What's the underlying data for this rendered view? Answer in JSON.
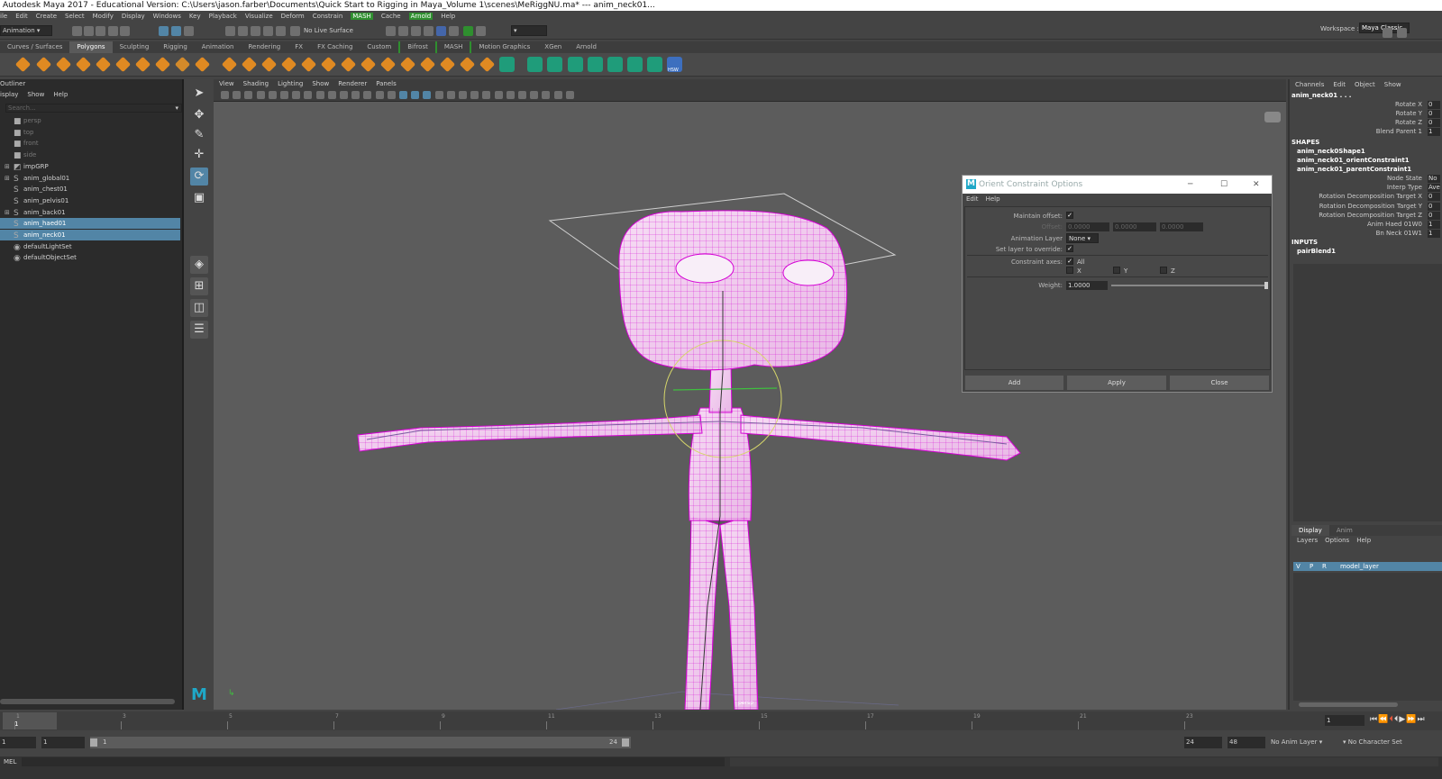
{
  "window": {
    "title": "Autodesk Maya 2017 - Educational Version: C:\\Users\\jason.farber\\Documents\\Quick Start to Rigging in Maya_Volume 1\\scenes\\MeRiggNU.ma*   ---   anim_neck01..."
  },
  "menubar": {
    "items": [
      "ile",
      "Edit",
      "Create",
      "Select",
      "Modify",
      "Display",
      "Windows",
      "Key",
      "Playback",
      "Visualize",
      "Deform",
      "Constrain",
      "MASH",
      "Cache",
      "Arnold",
      "Help"
    ],
    "workspace_label": "Workspace :",
    "workspace_value": "Maya Classic"
  },
  "statusline": {
    "mode": "Animation",
    "live_surface": "No Live Surface"
  },
  "shelf": {
    "tabs": [
      "Curves / Surfaces",
      "Polygons",
      "Sculpting",
      "Rigging",
      "Animation",
      "Rendering",
      "FX",
      "FX Caching",
      "Custom",
      "Bifrost",
      "MASH",
      "Motion Graphics",
      "XGen",
      "Arnold"
    ],
    "active": "Polygons",
    "hsw_label": "HSW"
  },
  "outliner": {
    "title": "Outliner",
    "menu": [
      "isplay",
      "Show",
      "Help"
    ],
    "search_placeholder": "Search...",
    "items": [
      {
        "label": "persp",
        "state": "dim"
      },
      {
        "label": "top",
        "state": "dim"
      },
      {
        "label": "front",
        "state": "dim"
      },
      {
        "label": "side",
        "state": "dim"
      },
      {
        "label": "impGRP",
        "state": "normal"
      },
      {
        "label": "anim_global01",
        "state": "normal"
      },
      {
        "label": "anim_chest01",
        "state": "normal"
      },
      {
        "label": "anim_pelvis01",
        "state": "normal"
      },
      {
        "label": "anim_back01",
        "state": "normal"
      },
      {
        "label": "anim_haed01",
        "state": "selected"
      },
      {
        "label": "anim_neck01",
        "state": "selected"
      },
      {
        "label": "defaultLightSet",
        "state": "normal"
      },
      {
        "label": "defaultObjectSet",
        "state": "normal"
      }
    ]
  },
  "viewport": {
    "menu": [
      "View",
      "Shading",
      "Lighting",
      "Show",
      "Renderer",
      "Panels"
    ],
    "camera_label": "persp"
  },
  "dialog": {
    "title": "Orient Constraint Options",
    "menu": [
      "Edit",
      "Help"
    ],
    "maintain_offset_label": "Maintain offset:",
    "offset_label": "Offset:",
    "offset_values": [
      "0.0000",
      "0.0000",
      "0.0000"
    ],
    "anim_layer_label": "Animation Layer",
    "anim_layer_value": "None",
    "set_layer_label": "Set layer to override:",
    "constraint_axes_label": "Constraint axes:",
    "all_label": "All",
    "axes": [
      "X",
      "Y",
      "Z"
    ],
    "weight_label": "Weight:",
    "weight_value": "1.0000",
    "weight_fraction": 1.0,
    "buttons": {
      "add": "Add",
      "apply": "Apply",
      "close": "Close"
    }
  },
  "channels": {
    "tabs": [
      "Channels",
      "Edit",
      "Object",
      "Show"
    ],
    "node": "anim_neck01 . . .",
    "attrs": [
      {
        "name": "Rotate X",
        "value": "0"
      },
      {
        "name": "Rotate Y",
        "value": "0"
      },
      {
        "name": "Rotate Z",
        "value": "0"
      },
      {
        "name": "Blend Parent 1",
        "value": "1"
      }
    ],
    "shapes_header": "SHAPES",
    "shapes": [
      "anim_neck0Shape1",
      "anim_neck01_orientConstraint1",
      "anim_neck01_parentConstraint1"
    ],
    "constraint_attrs": [
      {
        "name": "Node State",
        "value": "No"
      },
      {
        "name": "Interp Type",
        "value": "Ave"
      },
      {
        "name": "Rotation Decomposition Target X",
        "value": "0"
      },
      {
        "name": "Rotation Decomposition Target Y",
        "value": "0"
      },
      {
        "name": "Rotation Decomposition Target Z",
        "value": "0"
      },
      {
        "name": "Anim Haed 01W0",
        "value": "1"
      },
      {
        "name": "Bn Neck 01W1",
        "value": "1"
      }
    ],
    "inputs_header": "INPUTS",
    "inputs": [
      "pairBlend1"
    ]
  },
  "layers": {
    "tabs": [
      "Display",
      "Anim"
    ],
    "menu": [
      "Layers",
      "Options",
      "Help"
    ],
    "row": {
      "v": "V",
      "p": "P",
      "r": "R",
      "name": "model_layer"
    }
  },
  "timeline": {
    "ticks": [
      "1",
      "3",
      "5",
      "7",
      "9",
      "11",
      "13",
      "15",
      "17",
      "19",
      "21",
      "23"
    ],
    "current_frame": "1",
    "current_display": "1"
  },
  "range": {
    "start": "1",
    "start2": "1",
    "bar_start": "1",
    "bar_end": "24",
    "end": "24",
    "end2": "48",
    "anim_layer": "No Anim Layer",
    "char_set": "No Character Set"
  },
  "cmdline": {
    "label": "MEL"
  },
  "colors": {
    "selection": "#5285a6",
    "wire": "#d400d4",
    "accent_green": "#2f8f2f"
  }
}
